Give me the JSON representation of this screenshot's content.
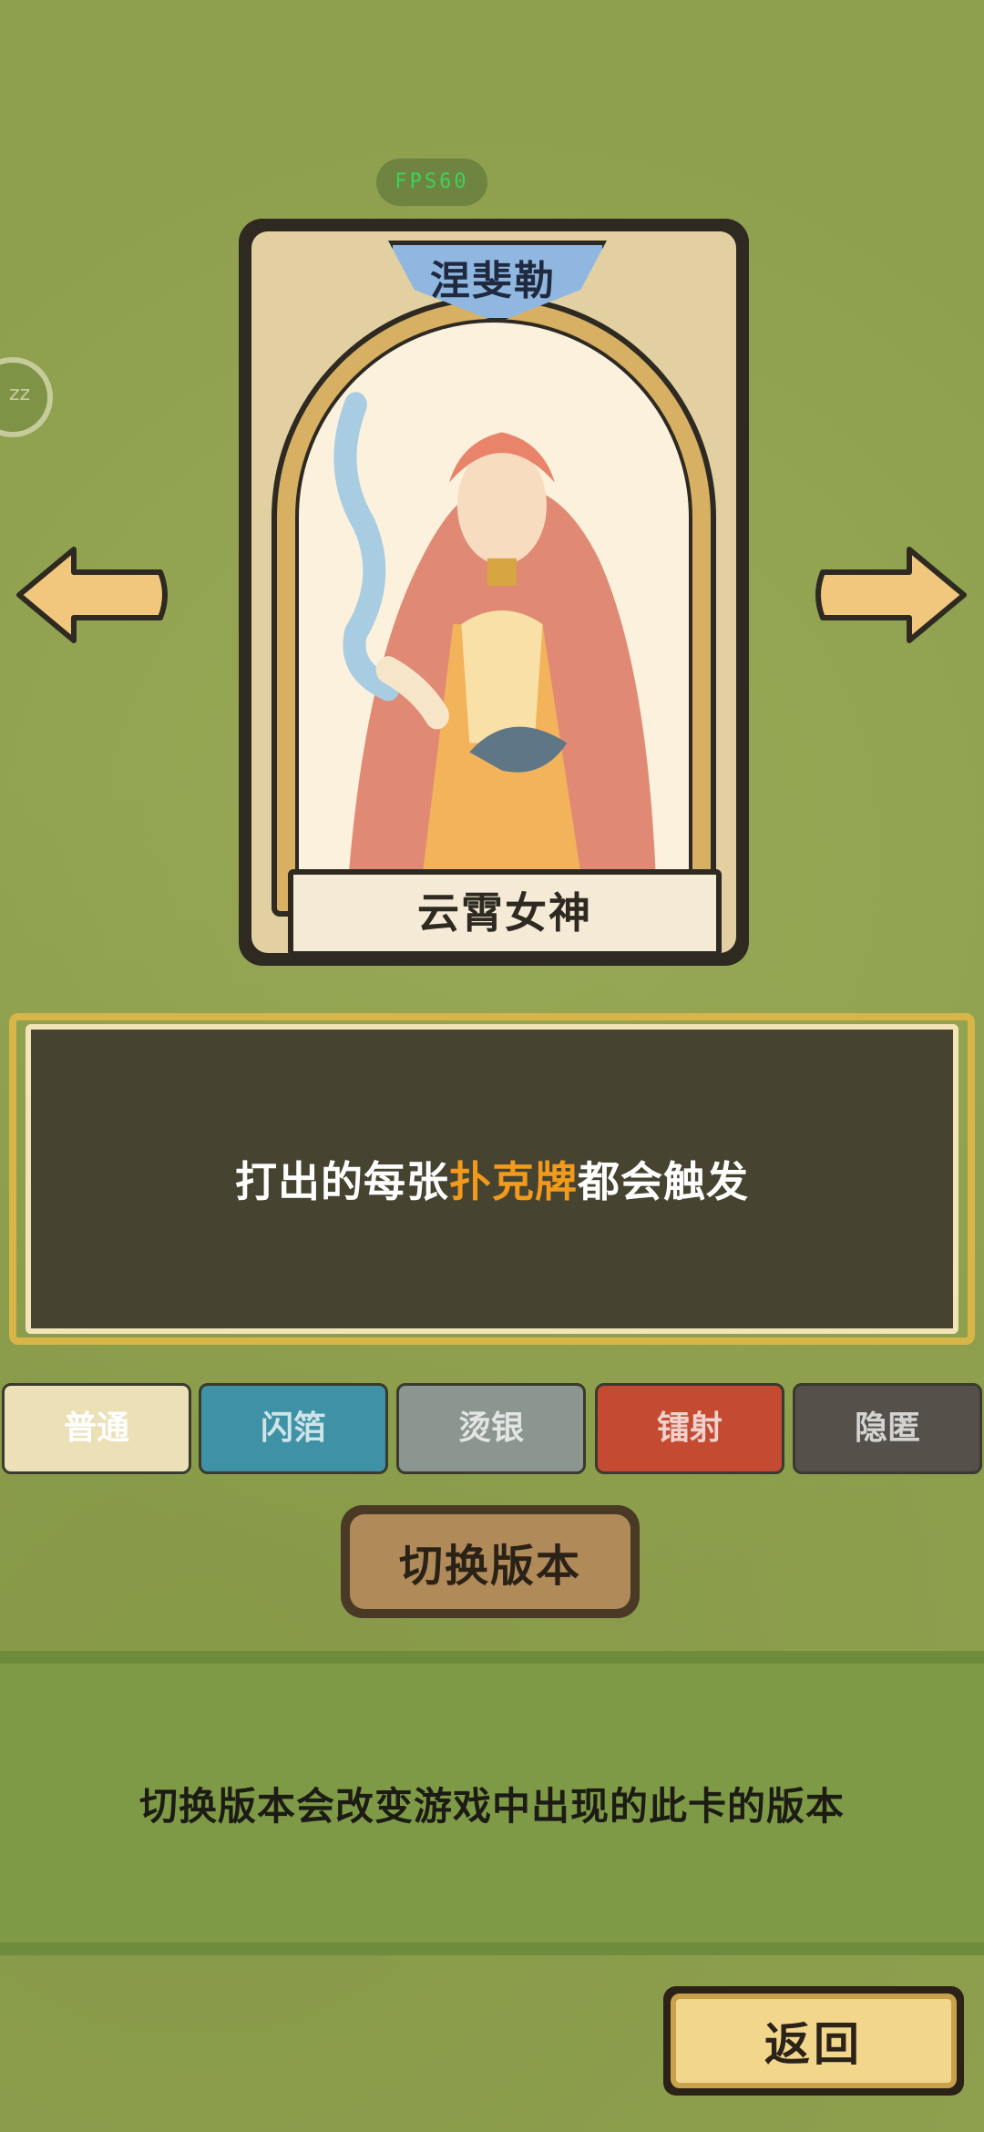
{
  "hud": {
    "fps_label": "FPS60",
    "side_badge_text": "zz"
  },
  "card": {
    "title": "涅斐勒",
    "name": "云霄女神",
    "art_description_icon": "goddess-portrait"
  },
  "navigation": {
    "left_icon": "arrow-left-icon",
    "right_icon": "arrow-right-icon"
  },
  "description": {
    "prefix": "打出的每张",
    "highlight": "扑克牌",
    "suffix": "都会触发",
    "highlight_color": "#f29a1c"
  },
  "variants": [
    {
      "label": "普通",
      "color": "#ece0b7"
    },
    {
      "label": "闪箔",
      "color": "#3f92a5"
    },
    {
      "label": "烫银",
      "color": "#8c9690"
    },
    {
      "label": "镭射",
      "color": "#c44a31"
    },
    {
      "label": "隐匿",
      "color": "#55504a"
    }
  ],
  "switch_button": {
    "label": "切换版本"
  },
  "info": {
    "text": "切换版本会改变游戏中出现的此卡的版本"
  },
  "back_button": {
    "label": "返回"
  }
}
